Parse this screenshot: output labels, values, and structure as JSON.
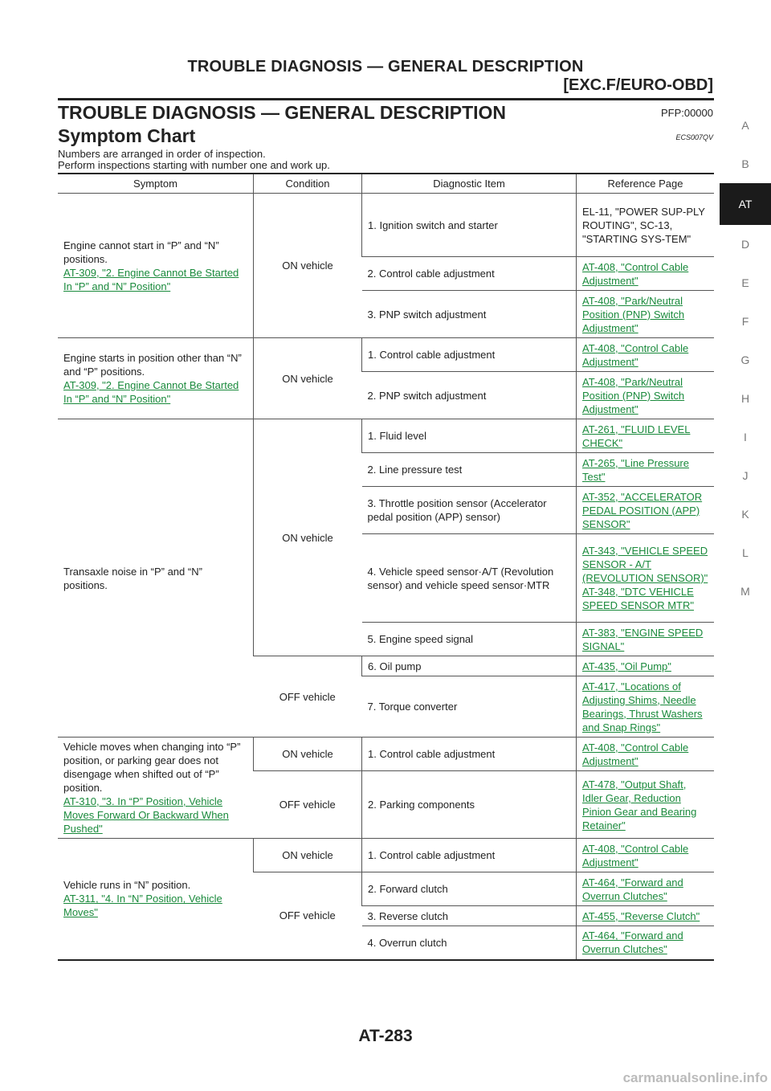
{
  "header": {
    "title": "TROUBLE DIAGNOSIS — GENERAL DESCRIPTION",
    "subtitle": "[EXC.F/EURO-OBD]"
  },
  "section": {
    "title": "TROUBLE DIAGNOSIS — GENERAL DESCRIPTION",
    "pfp": "PFP:00000"
  },
  "symptom_chart": {
    "title": "Symptom Chart",
    "code": "ECS007QV",
    "intro_line1": "Numbers are arranged in order of inspection.",
    "intro_line2": "Perform inspections starting with number one and work up."
  },
  "table": {
    "headers": [
      "Symptom",
      "Condition",
      "Diagnostic Item",
      "Reference Page"
    ],
    "groups": [
      {
        "symptom": "Engine cannot start in “P” and “N” positions.",
        "symptom_link": "AT-309, \"2. Engine Cannot Be Started In “P” and “N” Position\"",
        "conditions": [
          {
            "condition": "ON vehicle",
            "items": [
              {
                "diag": "1. Ignition switch and starter",
                "ref": "EL-11, \"POWER SUPPLY ROUTING\", SC-13, \"STARTING SYSTEM\"",
                "ref_display": "EL-11, \"POWER SUP-PLY ROUTING\", SC-13, \"STARTING SYS-TEM\"",
                "link": false
              },
              {
                "diag": "2. Control cable adjustment",
                "ref": "AT-408, \"Control Cable Adjustment\"",
                "link": true
              },
              {
                "diag": "3. PNP switch adjustment",
                "ref": "AT-408, \"Park/Neutral Position (PNP) Switch Adjustment\"",
                "link": true
              }
            ]
          }
        ]
      },
      {
        "symptom": "Engine starts in position other than “N” and “P” positions.",
        "symptom_link": "AT-309, \"2. Engine Cannot Be Started In “P” and “N” Position\"",
        "conditions": [
          {
            "condition": "ON vehicle",
            "items": [
              {
                "diag": "1. Control cable adjustment",
                "ref": "AT-408, \"Control Cable Adjustment\"",
                "link": true
              },
              {
                "diag": "2. PNP switch adjustment",
                "ref": "AT-408, \"Park/Neutral Position (PNP) Switch Adjustment\"",
                "link": true
              }
            ]
          }
        ]
      },
      {
        "symptom": "Transaxle noise in “P” and “N” positions.",
        "symptom_link": "",
        "conditions": [
          {
            "condition": "ON vehicle",
            "items": [
              {
                "diag": "1. Fluid level",
                "ref": "AT-261, \"FLUID LEVEL CHECK\"",
                "link": true
              },
              {
                "diag": "2. Line pressure test",
                "ref": "AT-265, \"Line Pressure Test\"",
                "link": true
              },
              {
                "diag": "3. Throttle position sensor (Accelerator pedal position (APP) sensor)",
                "ref": "AT-352, \"ACCELERATOR PEDAL POSITION (APP) SENSOR\"",
                "link": true
              },
              {
                "diag": "4. Vehicle speed sensor·A/T (Revolution sensor) and vehicle speed sensor·MTR",
                "ref": "AT-343, \"VEHICLE SPEED SENSOR - A/T (REVOLUTION SENSOR)\"",
                "ref2": "AT-348, \"DTC VEHICLE SPEED SENSOR MTR\"",
                "link": true
              },
              {
                "diag": "5. Engine speed signal",
                "ref": "AT-383, \"ENGINE SPEED SIGNAL\"",
                "link": true
              }
            ]
          },
          {
            "condition": "OFF vehicle",
            "items": [
              {
                "diag": "6. Oil pump",
                "ref": "AT-435, \"Oil Pump\"",
                "link": true
              },
              {
                "diag": "7. Torque converter",
                "ref": "AT-417, \"Locations of Adjusting Shims, Needle Bearings, Thrust Washers and Snap Rings\"",
                "link": true
              }
            ]
          }
        ]
      },
      {
        "symptom": "Vehicle moves when changing into “P” position, or parking gear does not disengage when shifted out of “P” position.",
        "symptom_link": "AT-310, \"3. In “P” Position, Vehicle Moves Forward Or Backward When Pushed\"",
        "conditions": [
          {
            "condition": "ON vehicle",
            "items": [
              {
                "diag": "1. Control cable adjustment",
                "ref": "AT-408, \"Control Cable Adjustment\"",
                "link": true
              }
            ]
          },
          {
            "condition": "OFF vehicle",
            "items": [
              {
                "diag": "2. Parking components",
                "ref": "AT-478, \"Output Shaft, Idler Gear, Reduction Pinion Gear and Bearing Retainer\"",
                "link": true
              }
            ]
          }
        ]
      },
      {
        "symptom": "Vehicle runs in “N” position.",
        "symptom_link": "AT-311, \"4. In “N” Position, Vehicle Moves\"",
        "conditions": [
          {
            "condition": "ON vehicle",
            "items": [
              {
                "diag": "1. Control cable adjustment",
                "ref": "AT-408, \"Control Cable Adjustment\"",
                "link": true
              }
            ]
          },
          {
            "condition": "OFF vehicle",
            "items": [
              {
                "diag": "2. Forward clutch",
                "ref": "AT-464, \"Forward and Overrun Clutches\"",
                "link": true
              },
              {
                "diag": "3. Reverse clutch",
                "ref": "AT-455, \"Reverse Clutch\"",
                "link": true
              },
              {
                "diag": "4. Overrun clutch",
                "ref": "AT-464, \"Forward and Overrun Clutches\"",
                "link": true
              }
            ]
          }
        ]
      }
    ]
  },
  "side_index": {
    "tabs": [
      "A",
      "B",
      "AT",
      "D",
      "E",
      "F",
      "G",
      "H",
      "I",
      "J",
      "K",
      "L",
      "M"
    ],
    "active": "AT"
  },
  "footer": {
    "page_number": "AT-283",
    "watermark": "carmanualsonline.info"
  }
}
